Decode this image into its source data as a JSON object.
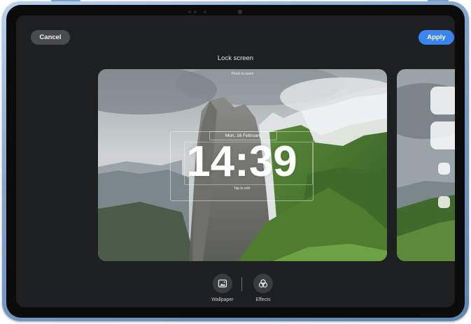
{
  "header": {
    "cancel_label": "Cancel",
    "apply_label": "Apply",
    "title": "Lock screen"
  },
  "preview": {
    "hint": "Pinch to zoom",
    "date": "Mon, 16 February",
    "time": "14:39",
    "edit_hint": "Tap to edit"
  },
  "toolbar": {
    "wallpaper_label": "Wallpaper",
    "effects_label": "Effects"
  },
  "colors": {
    "accent": "#3b84f0",
    "screen_bg": "#1e1f20",
    "device_frame": "#7fa3c9"
  },
  "icons": {
    "wallpaper": "image-icon",
    "effects": "effects-circles-icon"
  }
}
